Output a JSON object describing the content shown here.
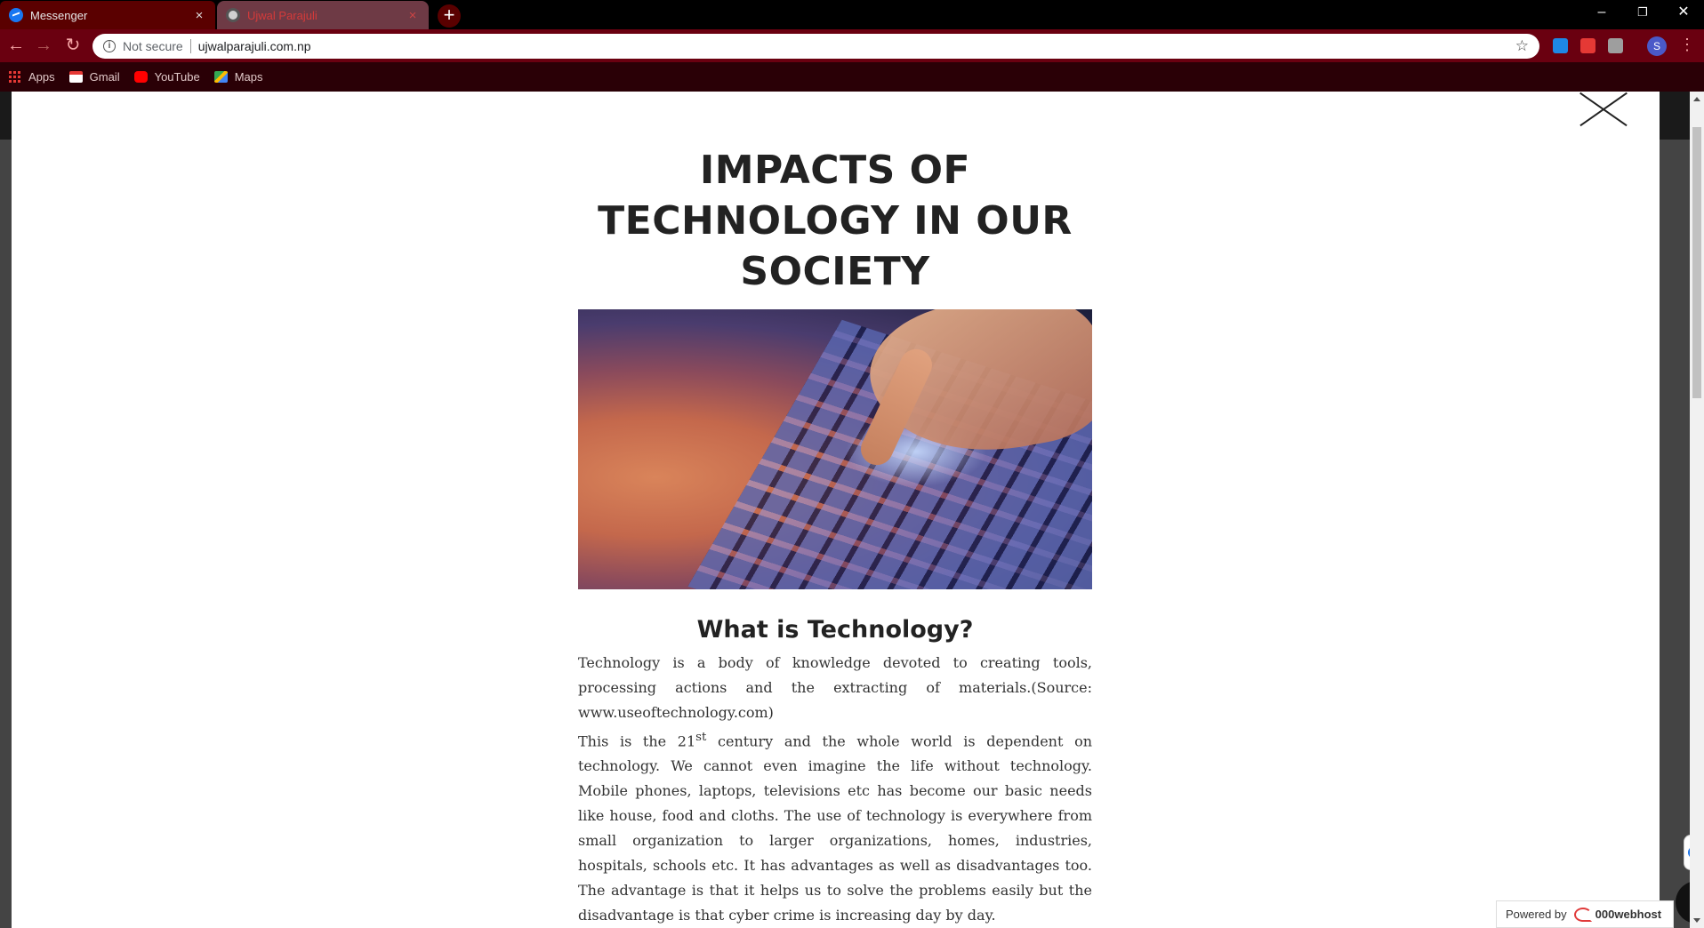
{
  "browser": {
    "tabs": [
      {
        "title": "Messenger",
        "close": "×"
      },
      {
        "title": "Ujwal Parajuli",
        "close": "×"
      }
    ],
    "new_tab": "+",
    "window_controls": {
      "minimize": "–",
      "restore": "❐",
      "close": "✕"
    },
    "nav": {
      "back": "←",
      "forward": "→",
      "reload": "↻"
    },
    "address": {
      "security_label": "Not secure",
      "url": "ujwalparajuli.com.np",
      "info": "i",
      "star": "☆"
    },
    "profile_initial": "S",
    "menu": "⋮",
    "bookmarks": [
      {
        "label": "Apps",
        "icon": "apps-grid-icon"
      },
      {
        "label": "Gmail",
        "icon": "gmail-icon"
      },
      {
        "label": "YouTube",
        "icon": "youtube-icon"
      },
      {
        "label": "Maps",
        "icon": "maps-icon"
      }
    ]
  },
  "article": {
    "title": "IMPACTS OF TECHNOLOGY IN OUR SOCIETY",
    "subtitle": "What is Technology?",
    "para1": "Technology is a body of knowledge devoted to creating tools, processing actions and the extracting of materials.(Source: www.useoftechnology.com)",
    "para2_before": "This is the 21",
    "para2_sup": "st",
    "para2_after": " century and the whole world is dependent on technology. We cannot even imagine the life without technology. Mobile phones, laptops, televisions etc has become our basic needs like house, food and cloths. The use of technology is everywhere from small organization to larger organizations, homes, industries, hospitals, schools etc. It has advantages as well as disadvantages too. The advantage is that it helps us to solve the problems easily but the disadvantage is that cyber crime is increasing day by day."
  },
  "footer": {
    "powered_by": "Powered by",
    "brand": "000webhost",
    "scroll_top": "⌃"
  },
  "colors": {
    "tabstrip": "#000000",
    "toolbar": "#6a0010",
    "bookmarks_bar": "#2a0006",
    "modal_bg": "#ffffff",
    "heading": "#222222"
  }
}
